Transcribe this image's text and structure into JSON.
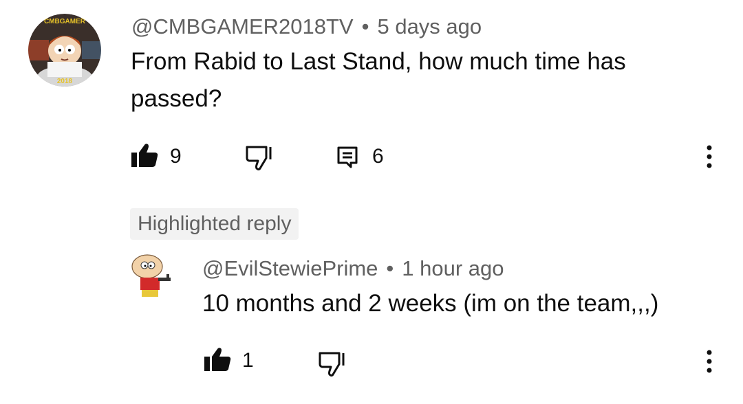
{
  "comment": {
    "author": "@CMBGAMER2018TV",
    "time": "5 days ago",
    "text": "From Rabid to Last Stand, how much time has passed?",
    "avatar_top_text": "CMBGAMER",
    "avatar_bottom_text": "2018",
    "likes": "9",
    "replies": "6"
  },
  "highlight_badge": "Highlighted reply",
  "reply": {
    "author": "@EvilStewiePrime",
    "time": "1 hour ago",
    "text": "10 months and 2 weeks (im on the team,,,)",
    "likes": "1"
  },
  "icons": [
    "like-icon",
    "dislike-icon",
    "reply-icon",
    "more-icon"
  ],
  "colors": {
    "text": "#0f0f0f",
    "secondary": "#606060",
    "badge_bg": "#f2f2f2"
  }
}
